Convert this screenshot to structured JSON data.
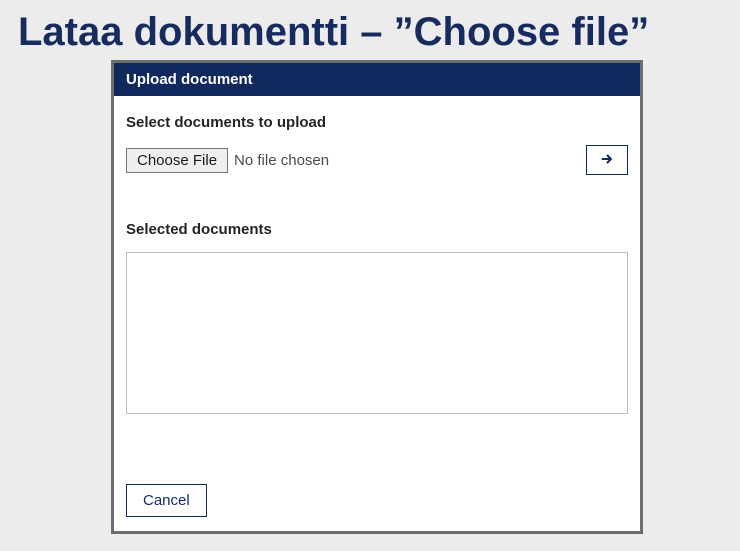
{
  "page": {
    "title": "Lataa dokumentti – ”Choose file”"
  },
  "dialog": {
    "header": "Upload document",
    "select_title": "Select documents to upload",
    "choose_file_label": "Choose File",
    "no_file_text": "No file chosen",
    "selected_title": "Selected documents",
    "cancel_label": "Cancel"
  }
}
